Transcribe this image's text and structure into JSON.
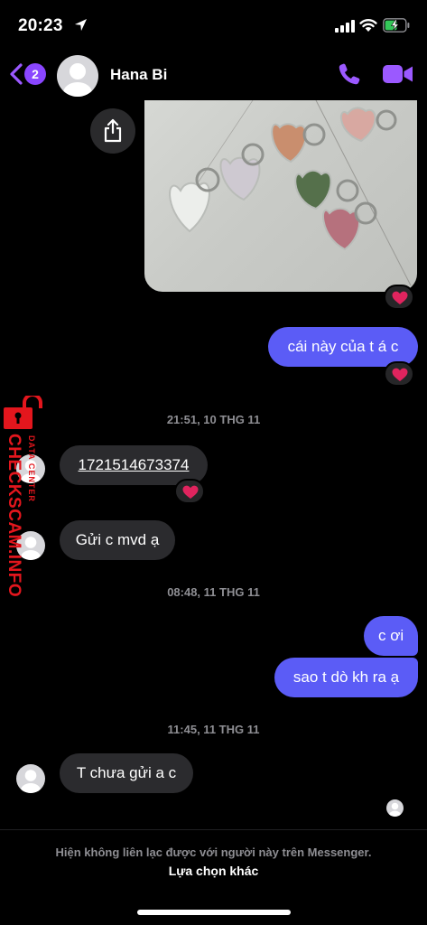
{
  "status_bar": {
    "time": "20:23",
    "icons": [
      "location-arrow-icon",
      "cellular-signal-icon",
      "wifi-icon",
      "battery-charging-icon"
    ],
    "battery_color": "#34c759"
  },
  "header": {
    "back_badge_count": "2",
    "contact_name": "Hana Bi",
    "accent_color": "#9b59ff",
    "icons": [
      "back-chevron-icon",
      "phone-icon",
      "video-camera-icon"
    ]
  },
  "messages": [
    {
      "type": "image",
      "direction": "outgoing",
      "reaction": "heart"
    },
    {
      "type": "text",
      "direction": "outgoing",
      "text": "cái này của t á c",
      "reaction": "heart"
    },
    {
      "type": "timestamp",
      "text": "21:51, 10 THG 11"
    },
    {
      "type": "text",
      "direction": "incoming",
      "text": "1721514673374",
      "link": true,
      "reaction": "heart"
    },
    {
      "type": "text",
      "direction": "incoming",
      "text": "Gửi c mvd ạ"
    },
    {
      "type": "timestamp",
      "text": "08:48, 11 THG 11"
    },
    {
      "type": "text",
      "direction": "outgoing",
      "text": "c ơi"
    },
    {
      "type": "text",
      "direction": "outgoing",
      "text": "sao t dò kh ra ạ"
    },
    {
      "type": "timestamp",
      "text": "11:45, 11 THG 11"
    },
    {
      "type": "text",
      "direction": "incoming",
      "text": "T chưa gửi a c"
    }
  ],
  "colors": {
    "outgoing_bubble": "#5b5cf6",
    "incoming_bubble": "#2b2b2e",
    "reaction_heart": "#e0245e",
    "watermark": "#e3161d"
  },
  "watermark": {
    "brand": "CHECKSCAM.INFO",
    "subtitle": "DATA CENTER"
  },
  "footer": {
    "notice": "Hiện không liên lạc được với người này trên Messenger.",
    "link": "Lựa chọn khác"
  }
}
